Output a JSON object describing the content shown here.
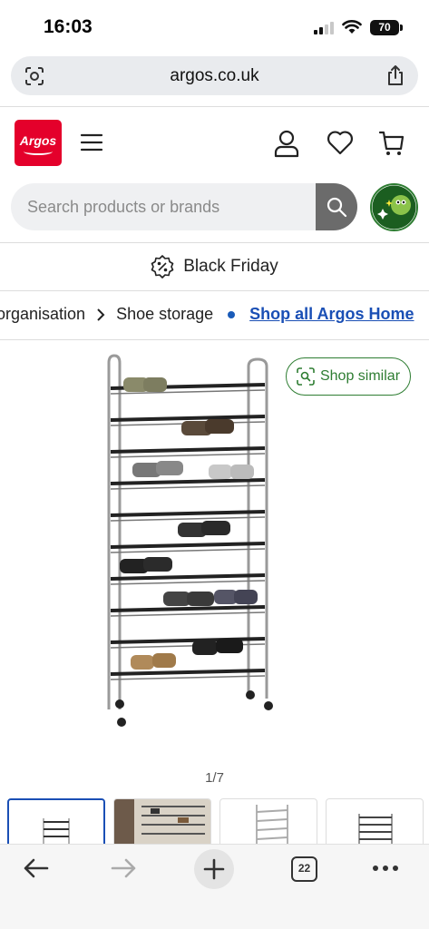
{
  "status_bar": {
    "time": "16:03",
    "battery": "70"
  },
  "browser": {
    "url": "argos.co.uk",
    "tab_count": "22"
  },
  "header": {
    "logo_text": "Argos"
  },
  "search": {
    "placeholder": "Search products or brands",
    "value": ""
  },
  "promo": {
    "label": "Black Friday"
  },
  "breadcrumb": {
    "items": [
      "organisation",
      "Shoe storage"
    ],
    "link": "Shop all Argos Home"
  },
  "product": {
    "shop_similar_label": "Shop similar",
    "image_counter": "1/7"
  },
  "colors": {
    "brand": "#e4002b",
    "link": "#1a4fb5",
    "accent_green": "#2e7d32"
  },
  "icons": [
    "lens-icon",
    "share-icon",
    "menu-icon",
    "account-icon",
    "heart-icon",
    "basket-icon",
    "search-icon",
    "sparkle-avatar-icon",
    "percent-badge-icon",
    "chevron-right-icon",
    "shop-similar-icon",
    "back-arrow-icon",
    "forward-arrow-icon",
    "plus-icon",
    "tabs-icon",
    "more-icon"
  ]
}
